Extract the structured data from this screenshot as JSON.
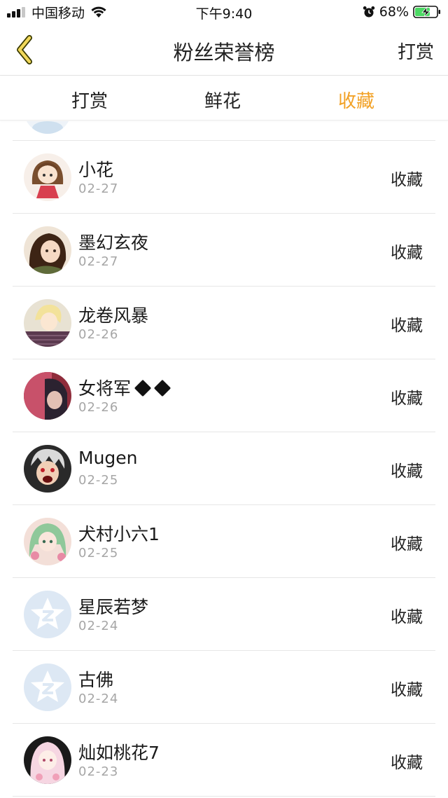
{
  "status_bar": {
    "carrier": "中国移动",
    "time": "下午9:40",
    "battery_percent": "68%"
  },
  "nav": {
    "title": "粉丝荣誉榜",
    "right_label": "打赏",
    "back_icon": "chevron-left-icon"
  },
  "tabs": [
    {
      "label": "打赏",
      "active": false
    },
    {
      "label": "鲜花",
      "active": false
    },
    {
      "label": "收藏",
      "active": true
    }
  ],
  "colors": {
    "accent": "#f2a125",
    "date": "#a6a6a6",
    "divider": "#e6e6e6"
  },
  "fans": [
    {
      "name": "小花",
      "date": "02-27",
      "action": "收藏",
      "avatar": "girl-red-dress"
    },
    {
      "name": "墨幻玄夜",
      "date": "02-27",
      "action": "收藏",
      "avatar": "brown-hair-girl"
    },
    {
      "name": "龙卷风暴",
      "date": "02-26",
      "action": "收藏",
      "avatar": "blonde-boy"
    },
    {
      "name": "女将军",
      "date": "02-26",
      "action": "收藏",
      "avatar": "dark-photo"
    },
    {
      "name": "Mugen",
      "date": "02-25",
      "action": "收藏",
      "avatar": "shouting-boy"
    },
    {
      "name": "犬村小六1",
      "date": "02-25",
      "action": "收藏",
      "avatar": "green-hair-girl"
    },
    {
      "name": "星辰若梦",
      "date": "02-24",
      "action": "收藏",
      "avatar": "default-star"
    },
    {
      "name": "古佛",
      "date": "02-24",
      "action": "收藏",
      "avatar": "default-star"
    },
    {
      "name": "灿如桃花7",
      "date": "02-23",
      "action": "收藏",
      "avatar": "pink-hair-girl"
    }
  ]
}
